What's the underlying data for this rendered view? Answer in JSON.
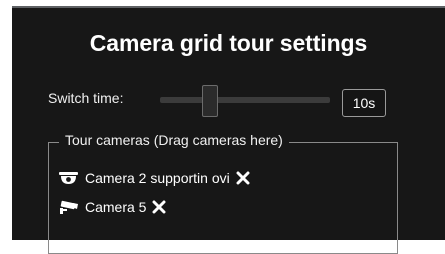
{
  "dialog": {
    "title": "Camera grid tour settings",
    "switch_time_label": "Switch time:",
    "switch_time_value": "10s",
    "slider_level": 0.27,
    "tour_cameras_label": "Tour cameras (Drag cameras here)"
  },
  "cameras": [
    {
      "label": "Camera 2 supportin ovi",
      "icon": "dome-camera-icon",
      "remove_icon": "close-icon"
    },
    {
      "label": "Camera 5",
      "icon": "bullet-camera-icon",
      "remove_icon": "close-icon"
    }
  ],
  "colors": {
    "panel_background": "#171717",
    "text": "#ffffff",
    "border": "#8a8a8a"
  }
}
